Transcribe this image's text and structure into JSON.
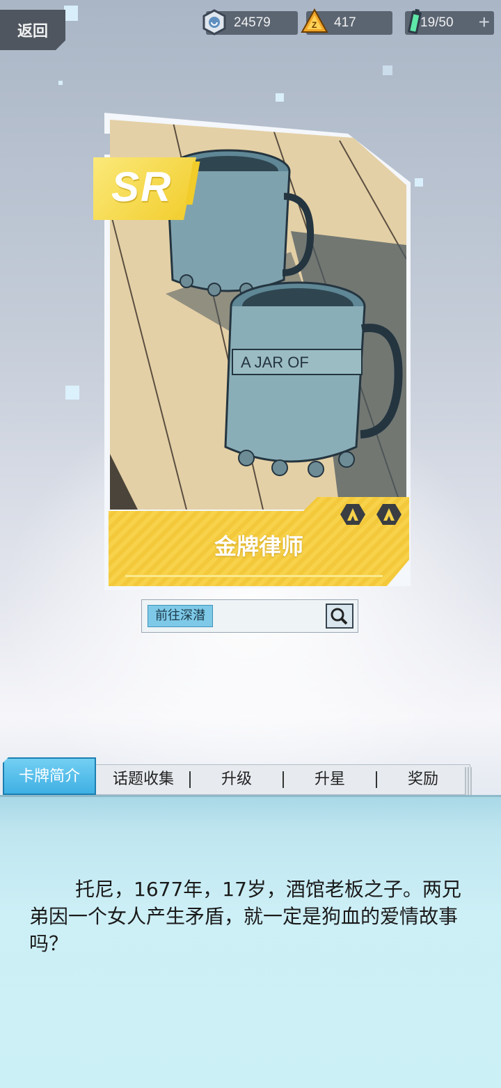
{
  "header": {
    "back_label": "返回",
    "currency_coins": "24579",
    "currency_gems": "417",
    "energy": "19/50",
    "add_symbol": "+"
  },
  "card": {
    "rarity": "SR",
    "name": "金牌律师",
    "art_subject": "two-pewter-beer-mugs",
    "mug_engraving": "A JAR OF"
  },
  "search": {
    "tag_label": "前往深潜"
  },
  "tabs": [
    {
      "label": "卡牌简介",
      "active": true
    },
    {
      "label": "话题收集",
      "active": false
    },
    {
      "label": "升级",
      "active": false
    },
    {
      "label": "升星",
      "active": false
    },
    {
      "label": "奖励",
      "active": false
    }
  ],
  "description": "托尼，1677年，17岁，酒馆老板之子。两兄弟因一个女人产生矛盾，就一定是狗血的爱情故事吗？",
  "colors": {
    "accent_yellow": "#f3c93b",
    "tab_active": "#3fb0e4",
    "panel_bg": "#cbf0f6"
  }
}
